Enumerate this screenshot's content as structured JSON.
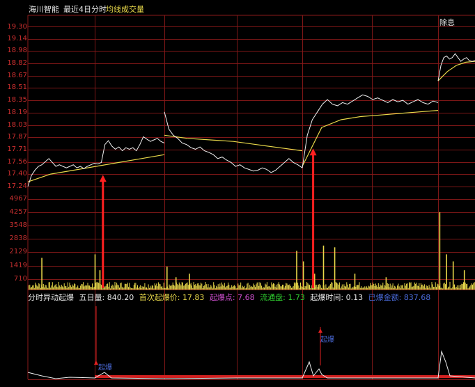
{
  "header": {
    "stock_name": "海川智能",
    "period": "最近4日分时",
    "legend_avg": "均线",
    "legend_vol": "成交量",
    "ex_dividend": "除息"
  },
  "price_axis": [
    "19.30",
    "19.14",
    "18.98",
    "18.82",
    "18.67",
    "18.51",
    "18.35",
    "18.19",
    "18.03",
    "17.87",
    "17.71",
    "17.56",
    "17.40",
    "17.24"
  ],
  "volume_axis": [
    "4967",
    "4257",
    "3548",
    "2838",
    "2129",
    "1419",
    "710"
  ],
  "indicator": {
    "name": "分时异动起爆",
    "five_day_label": "五日量:",
    "five_day_value": "840.20",
    "first_price_label": "首次起爆价:",
    "first_price_value": "17.83",
    "burst_point_label": "起爆点:",
    "burst_point_value": "7.68",
    "circulating_label": "流通盘:",
    "circulating_value": "1.73",
    "burst_time_label": "起爆时间:",
    "burst_time_value": "0.13",
    "burst_amount_label": "已爆金额:",
    "burst_amount_value": "837.68",
    "marker_label_1": "起爆",
    "marker_label_2": "起爆"
  },
  "colors": {
    "price_line": "#f0f0f0",
    "avg_line": "#e8d84a",
    "volume": "#e8d84a",
    "grid": "#8b1a1a",
    "arrow": "#ff2020",
    "axis_text": "#d23030",
    "indicator_name": "#e8e8e8",
    "burst_point": "#d050d0",
    "circulating": "#30d030",
    "burst_amount": "#4a6ad8"
  },
  "chart_data": {
    "type": "line",
    "title": "",
    "days": 4,
    "ylim": [
      17.24,
      19.3
    ],
    "price_series": {
      "name": "",
      "day1": [
        17.24,
        17.38,
        17.45,
        17.5,
        17.52,
        17.56,
        17.6,
        17.55,
        17.5,
        17.52,
        17.5,
        17.48,
        17.5,
        17.52,
        17.48,
        17.5,
        17.47,
        17.5,
        17.52,
        17.54,
        17.53,
        17.55,
        17.78,
        17.83,
        17.76,
        17.72,
        17.75,
        17.7,
        17.74,
        17.72,
        17.74,
        17.7,
        17.78,
        17.88,
        17.85,
        17.82,
        17.84,
        17.86,
        17.82,
        17.8
      ],
      "day2": [
        18.2,
        17.98,
        17.9,
        17.86,
        17.8,
        17.78,
        17.74,
        17.72,
        17.75,
        17.7,
        17.68,
        17.65,
        17.6,
        17.62,
        17.58,
        17.55,
        17.5,
        17.52,
        17.48,
        17.46,
        17.44,
        17.45,
        17.48,
        17.46,
        17.42,
        17.45,
        17.5,
        17.55,
        17.6,
        17.55,
        17.52,
        17.48
      ],
      "day3": [
        17.48,
        17.9,
        18.1,
        18.2,
        18.3,
        18.36,
        18.3,
        18.28,
        18.32,
        18.3,
        18.34,
        18.38,
        18.42,
        18.4,
        18.36,
        18.38,
        18.35,
        18.32,
        18.36,
        18.33,
        18.35,
        18.3,
        18.33,
        18.36,
        18.32,
        18.3,
        18.34,
        18.32
      ],
      "day4": [
        18.6,
        18.8,
        18.9,
        18.92,
        18.88,
        18.9,
        18.95,
        18.9,
        18.85,
        18.88,
        18.9,
        18.86,
        18.85,
        18.86
      ]
    },
    "avg_series": {
      "name": "",
      "day1": [
        17.3,
        17.4,
        17.45,
        17.5,
        17.55,
        17.6,
        17.65
      ],
      "day2": [
        17.9,
        17.86,
        17.84,
        17.82,
        17.78,
        17.74,
        17.7
      ],
      "day3": [
        17.5,
        18.0,
        18.1,
        18.14,
        18.16,
        18.18,
        18.2,
        18.22
      ],
      "day4": [
        18.6,
        18.72,
        18.8,
        18.84,
        18.85
      ]
    },
    "volume": {
      "ylim": [
        0,
        5300
      ],
      "peaks": [
        {
          "pos": 0.03,
          "v": 1800
        },
        {
          "pos": 0.149,
          "v": 2000
        },
        {
          "pos": 0.16,
          "v": 1100
        },
        {
          "pos": 0.31,
          "v": 1300
        },
        {
          "pos": 0.33,
          "v": 700
        },
        {
          "pos": 0.36,
          "v": 900
        },
        {
          "pos": 0.6,
          "v": 2200
        },
        {
          "pos": 0.615,
          "v": 1600
        },
        {
          "pos": 0.64,
          "v": 900
        },
        {
          "pos": 0.66,
          "v": 2500
        },
        {
          "pos": 0.685,
          "v": 2400
        },
        {
          "pos": 0.73,
          "v": 900
        },
        {
          "pos": 0.8,
          "v": 700
        },
        {
          "pos": 0.92,
          "v": 4400
        },
        {
          "pos": 0.935,
          "v": 2000
        },
        {
          "pos": 0.95,
          "v": 1600
        },
        {
          "pos": 0.975,
          "v": 1100
        }
      ]
    },
    "arrows": [
      {
        "day": 1,
        "pos_in_day": 0.55,
        "price": 17.39
      },
      {
        "day": 3,
        "pos_in_day": 0.08,
        "price": 17.73
      }
    ]
  }
}
